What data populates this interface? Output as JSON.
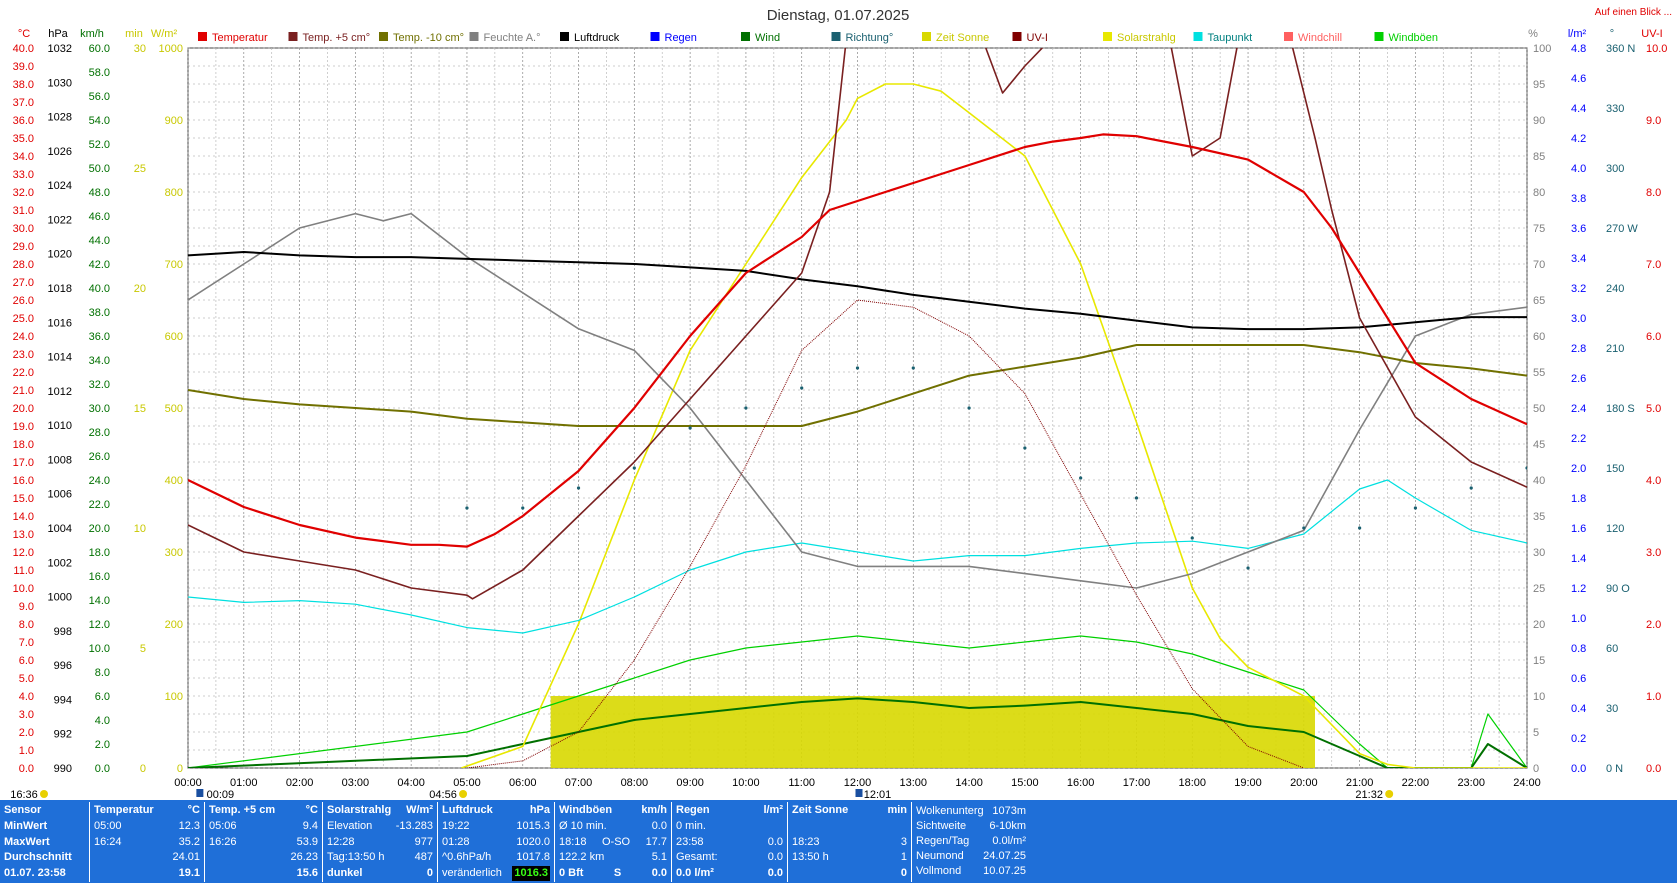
{
  "title": "Dienstag, 01.07.2025",
  "top_link": "Auf einen Blick ...",
  "legend": [
    {
      "label": "Temperatur",
      "color": "#e00000"
    },
    {
      "label": "Temp. +5 cm°",
      "color": "#7a2020"
    },
    {
      "label": "Temp. -10 cm°",
      "color": "#707000"
    },
    {
      "label": "Feuchte A.°",
      "color": "#808080"
    },
    {
      "label": "Luftdruck",
      "color": "#000000"
    },
    {
      "label": "Regen",
      "color": "#0000ff"
    },
    {
      "label": "Wind",
      "color": "#007000"
    },
    {
      "label": "Richtung°",
      "color": "#1a6070"
    },
    {
      "label": "Zeit Sonne",
      "color": "#d8d800"
    },
    {
      "label": "UV-I",
      "color": "#800000"
    },
    {
      "label": "Solarstrahlg",
      "color": "#e8e800"
    },
    {
      "label": "Taupunkt",
      "color": "#00e0e0"
    },
    {
      "label": "Windchill",
      "color": "#ff6060"
    },
    {
      "label": "Windböen",
      "color": "#00d000"
    }
  ],
  "axes": {
    "temp": {
      "unit": "°C",
      "color": "#e00000",
      "ticks": [
        "40.0",
        "39.0",
        "38.0",
        "37.0",
        "36.0",
        "35.0",
        "34.0",
        "33.0",
        "32.0",
        "31.0",
        "30.0",
        "29.0",
        "28.0",
        "27.0",
        "26.0",
        "25.0",
        "24.0",
        "23.0",
        "22.0",
        "21.0",
        "20.0",
        "19.0",
        "18.0",
        "17.0",
        "16.0",
        "15.0",
        "14.0",
        "13.0",
        "12.0",
        "11.0",
        "10.0",
        "9.0",
        "8.0",
        "7.0",
        "6.0",
        "5.0",
        "4.0",
        "3.0",
        "2.0",
        "1.0",
        "0.0"
      ]
    },
    "hpa": {
      "unit": "hPa",
      "color": "#000000",
      "ticks": [
        "1032",
        "1030",
        "1028",
        "1026",
        "1024",
        "1022",
        "1020",
        "1018",
        "1016",
        "1014",
        "1012",
        "1010",
        "1008",
        "1006",
        "1004",
        "1002",
        "1000",
        "998",
        "996",
        "994",
        "992",
        "990"
      ]
    },
    "kmh": {
      "unit": "km/h",
      "color": "#007000",
      "ticks": [
        "60.0",
        "58.0",
        "56.0",
        "54.0",
        "52.0",
        "50.0",
        "48.0",
        "46.0",
        "44.0",
        "42.0",
        "40.0",
        "38.0",
        "36.0",
        "34.0",
        "32.0",
        "30.0",
        "28.0",
        "26.0",
        "24.0",
        "22.0",
        "20.0",
        "18.0",
        "16.0",
        "14.0",
        "12.0",
        "10.0",
        "8.0",
        "6.0",
        "4.0",
        "2.0",
        "0.0"
      ]
    },
    "min": {
      "unit": "min",
      "color": "#c8c800",
      "ticks": [
        "30",
        "25",
        "20",
        "15",
        "10",
        "5",
        "0"
      ]
    },
    "wm2": {
      "unit": "W/m²",
      "color": "#c8c800",
      "ticks": [
        "1000",
        "900",
        "800",
        "700",
        "600",
        "500",
        "400",
        "300",
        "200",
        "100",
        "0"
      ]
    },
    "pct": {
      "unit": "%",
      "color": "#808080",
      "ticks": [
        "100",
        "95",
        "90",
        "85",
        "80",
        "75",
        "70",
        "65",
        "60",
        "55",
        "50",
        "45",
        "40",
        "35",
        "30",
        "25",
        "20",
        "15",
        "10",
        "5",
        "0"
      ]
    },
    "lm2": {
      "unit": "l/m²",
      "color": "#0000ff",
      "ticks": [
        "4.8",
        "4.6",
        "4.4",
        "4.2",
        "4.0",
        "3.8",
        "3.6",
        "3.4",
        "3.2",
        "3.0",
        "2.8",
        "2.6",
        "2.4",
        "2.2",
        "2.0",
        "1.8",
        "1.6",
        "1.4",
        "1.2",
        "1.0",
        "0.8",
        "0.6",
        "0.4",
        "0.2",
        "0.0"
      ]
    },
    "deg": {
      "unit": "°",
      "color": "#1a6070",
      "ticks": [
        "360 N",
        "330",
        "300",
        "270 W",
        "240",
        "210",
        "180 S",
        "150",
        "120",
        "90 O",
        "60",
        "30",
        "0   N"
      ]
    },
    "uv": {
      "unit": "UV-I",
      "color": "#e00000",
      "ticks": [
        "10.0",
        "9.0",
        "8.0",
        "7.0",
        "6.0",
        "5.0",
        "4.0",
        "3.0",
        "2.0",
        "1.0",
        "0.0"
      ]
    },
    "x_ticks": [
      "00:00",
      "01:00",
      "02:00",
      "03:00",
      "04:00",
      "05:00",
      "06:00",
      "07:00",
      "08:00",
      "09:00",
      "10:00",
      "11:00",
      "12:00",
      "13:00",
      "14:00",
      "15:00",
      "16:00",
      "17:00",
      "18:00",
      "19:00",
      "20:00",
      "21:00",
      "22:00",
      "23:00",
      "24:00"
    ]
  },
  "markers": {
    "left_time": "16:36",
    "moonrise": "00:09",
    "sunrise": "04:56",
    "noon": "12:01",
    "sunset": "21:32"
  },
  "chart_data": {
    "type": "line",
    "title": "Dienstag, 01.07.2025",
    "x_unit": "hours",
    "x_range": [
      0,
      24
    ],
    "grid": true,
    "legend_position": "top",
    "series": [
      {
        "name": "Temperatur",
        "axis": "temp",
        "color": "#e00000",
        "x": [
          0,
          1,
          2,
          3,
          4,
          4.5,
          5,
          5.5,
          6,
          7,
          8,
          9,
          10,
          10.5,
          11,
          11.5,
          12,
          13,
          14,
          15,
          15.5,
          16,
          16.4,
          17,
          18,
          19,
          20,
          20.5,
          21,
          22,
          23,
          24
        ],
        "y": [
          16.0,
          14.5,
          13.5,
          12.8,
          12.4,
          12.4,
          12.3,
          13.0,
          14.0,
          16.5,
          20.0,
          24.0,
          27.5,
          28.5,
          29.5,
          31.0,
          31.5,
          32.5,
          33.5,
          34.5,
          34.8,
          35.0,
          35.2,
          35.1,
          34.5,
          33.8,
          32.0,
          30.0,
          27.5,
          22.5,
          20.5,
          19.1
        ]
      },
      {
        "name": "Temp. +5 cm°",
        "axis": "temp",
        "color": "#7a2020",
        "x": [
          0,
          1,
          2,
          3,
          4,
          5,
          5.1,
          6,
          7,
          8,
          9,
          10,
          11,
          11.5,
          11.8,
          12,
          12.5,
          13,
          13.5,
          14,
          14.3,
          14.6,
          15,
          16,
          17,
          17.5,
          18,
          18.5,
          18.8,
          19.2,
          19.8,
          20.2,
          20.5,
          21,
          22,
          23,
          24
        ],
        "y": [
          13.5,
          12.0,
          11.5,
          11.0,
          10.0,
          9.6,
          9.4,
          11.0,
          14.0,
          17.0,
          20.5,
          24.0,
          27.5,
          32.0,
          40.5,
          43.0,
          45.0,
          45.0,
          44.0,
          42.5,
          40.0,
          37.5,
          39.0,
          44.0,
          44.5,
          42.0,
          34.0,
          35.0,
          40.0,
          42.0,
          40.0,
          35.0,
          31.0,
          25.0,
          19.5,
          17.0,
          15.6
        ]
      },
      {
        "name": "Temp. -10 cm°",
        "axis": "temp",
        "color": "#707000",
        "x": [
          0,
          1,
          2,
          3,
          4,
          5,
          6,
          7,
          8,
          9,
          10,
          11,
          12,
          13,
          14,
          15,
          16,
          17,
          18,
          19,
          20,
          21,
          22,
          23,
          24
        ],
        "y": [
          21.0,
          20.5,
          20.2,
          20.0,
          19.8,
          19.4,
          19.2,
          19.0,
          19.0,
          19.0,
          19.0,
          19.0,
          19.8,
          20.8,
          21.8,
          22.3,
          22.8,
          23.5,
          23.5,
          23.5,
          23.5,
          23.1,
          22.5,
          22.2,
          21.8
        ]
      },
      {
        "name": "Feuchte A.°",
        "axis": "pct",
        "color": "#808080",
        "x": [
          0,
          1,
          2,
          3,
          3.5,
          4,
          5,
          6,
          7,
          8,
          9,
          10,
          11,
          12,
          13,
          14,
          15,
          16,
          17,
          18,
          19,
          20,
          21,
          22,
          23,
          24
        ],
        "y": [
          65,
          70,
          75,
          77,
          76,
          77,
          71,
          66,
          61,
          58,
          50,
          40,
          30,
          28,
          28,
          28,
          27,
          26,
          25,
          27,
          30,
          33,
          47,
          60,
          63,
          64
        ]
      },
      {
        "name": "Luftdruck",
        "axis": "hpa",
        "color": "#000000",
        "x": [
          0,
          1,
          2,
          3,
          4,
          5,
          6,
          7,
          8,
          9,
          10,
          11,
          12,
          13,
          14,
          15,
          16,
          17,
          18,
          19,
          20,
          21,
          22,
          23,
          24
        ],
        "y": [
          1019.9,
          1020.1,
          1019.9,
          1019.8,
          1019.8,
          1019.7,
          1019.6,
          1019.5,
          1019.4,
          1019.2,
          1019.0,
          1018.5,
          1018.1,
          1017.6,
          1017.2,
          1016.8,
          1016.5,
          1016.1,
          1015.7,
          1015.6,
          1015.6,
          1015.7,
          1016.0,
          1016.3,
          1016.3
        ]
      },
      {
        "name": "Taupunkt",
        "axis": "temp",
        "color": "#00e0e0",
        "x": [
          0,
          1,
          2,
          3,
          4,
          5,
          6,
          7,
          8,
          9,
          10,
          11,
          12,
          13,
          14,
          15,
          16,
          17,
          18,
          19,
          20,
          21,
          21.5,
          22,
          23,
          24
        ],
        "y": [
          9.5,
          9.2,
          9.3,
          9.1,
          8.5,
          7.8,
          7.5,
          8.2,
          9.5,
          11.0,
          12.0,
          12.5,
          12.0,
          11.5,
          11.8,
          11.8,
          12.2,
          12.5,
          12.6,
          12.2,
          13.0,
          15.5,
          16.0,
          15.0,
          13.2,
          12.5
        ]
      },
      {
        "name": "Solarstrahlg",
        "axis": "wm2",
        "color": "#e8e800",
        "x": [
          4.9,
          6,
          7,
          8,
          9,
          10,
          10.5,
          11,
          11.5,
          11.8,
          12,
          12.5,
          13,
          13.5,
          14,
          14.5,
          15,
          16,
          17,
          18,
          18.5,
          19,
          19.5,
          20,
          21,
          21.5,
          22,
          23,
          24
        ],
        "y": [
          0,
          30,
          200,
          400,
          580,
          700,
          760,
          820,
          870,
          900,
          930,
          950,
          950,
          940,
          910,
          880,
          850,
          700,
          480,
          250,
          180,
          140,
          120,
          100,
          20,
          5,
          0,
          0,
          0
        ]
      },
      {
        "name": "UV-I",
        "axis": "uv",
        "color": "#800000",
        "x": [
          5,
          6,
          7,
          8,
          9,
          10,
          11,
          12,
          13,
          14,
          15,
          16,
          17,
          18,
          18.5,
          19,
          20
        ],
        "y": [
          0,
          0.1,
          0.5,
          1.5,
          2.8,
          4.2,
          5.8,
          6.5,
          6.4,
          6.0,
          5.2,
          3.8,
          2.4,
          1.1,
          0.7,
          0.3,
          0
        ]
      },
      {
        "name": "Wind",
        "axis": "kmh",
        "color": "#007000",
        "x": [
          0,
          5,
          6,
          7,
          8,
          9,
          10,
          11,
          12,
          13,
          14,
          15,
          16,
          17,
          18,
          19,
          20,
          21,
          21.5,
          23,
          23.3,
          24
        ],
        "y": [
          0,
          1.0,
          2.0,
          3.0,
          4.0,
          4.5,
          5.0,
          5.5,
          5.8,
          5.5,
          5.0,
          5.2,
          5.5,
          5.0,
          4.5,
          3.5,
          3.0,
          1.0,
          0.0,
          0.0,
          2.0,
          0.0
        ]
      },
      {
        "name": "Windböen",
        "axis": "kmh",
        "color": "#00d000",
        "x": [
          0,
          5,
          6,
          7,
          8,
          9,
          10,
          11,
          12,
          13,
          14,
          15,
          16,
          17,
          18,
          19,
          20,
          21,
          21.5,
          23,
          23.3,
          24
        ],
        "y": [
          0,
          3.0,
          4.5,
          6.0,
          7.5,
          9.0,
          10.0,
          10.5,
          11.0,
          10.5,
          10.0,
          10.5,
          11.0,
          10.5,
          9.5,
          8.0,
          6.5,
          2.0,
          0.0,
          0.0,
          4.5,
          0.0
        ]
      },
      {
        "name": "Richtung°",
        "axis": "deg",
        "color": "#1a6070",
        "x": [
          5,
          6,
          7,
          8,
          9,
          10,
          11,
          12,
          13,
          14,
          15,
          16,
          17,
          18,
          19,
          20,
          21,
          22,
          23,
          24
        ],
        "y": [
          130,
          130,
          140,
          150,
          170,
          180,
          190,
          200,
          200,
          180,
          160,
          145,
          135,
          115,
          100,
          120,
          120,
          130,
          140,
          150
        ]
      }
    ],
    "sunshine": {
      "name": "Zeit Sonne",
      "axis": "min",
      "color": "#d8d800",
      "x_start": 6.5,
      "x_end": 20.2,
      "value": 3
    }
  },
  "summary": {
    "sensor": {
      "header": "Sensor",
      "rows": [
        "MinWert",
        "MaxWert",
        "Durchschnitt",
        "01.07. 23:58"
      ]
    },
    "temp": {
      "header": "Temperatur",
      "unit": "°C",
      "rows": [
        [
          "05:00",
          "12.3"
        ],
        [
          "16:24",
          "35.2"
        ],
        [
          "",
          "24.01"
        ],
        [
          "",
          "19.1"
        ]
      ]
    },
    "temp5": {
      "header": "Temp. +5 cm",
      "unit": "°C",
      "rows": [
        [
          "05:06",
          "9.4"
        ],
        [
          "16:26",
          "53.9"
        ],
        [
          "",
          "26.23"
        ],
        [
          "",
          "15.6"
        ]
      ]
    },
    "solar": {
      "header": "Solarstrahlg",
      "unit": "W/m²",
      "rows": [
        [
          "Elevation",
          "-13.283"
        ],
        [
          "12:28",
          "977"
        ],
        [
          "Tag:13:50 h",
          "487"
        ],
        [
          "dunkel",
          "0"
        ]
      ]
    },
    "press": {
      "header": "Luftdruck",
      "unit": "hPa",
      "rows": [
        [
          "19:22",
          "1015.3"
        ],
        [
          "01:28",
          "1020.0"
        ],
        [
          "^0.6hPa/h",
          "1017.8"
        ],
        [
          "veränderlich",
          "1016.3"
        ]
      ]
    },
    "gust": {
      "header": "Windböen",
      "unit": "km/h",
      "rows": [
        [
          "Ø 10 min.",
          "",
          "0.0"
        ],
        [
          "18:18",
          "O-SO",
          "17.7"
        ],
        [
          "122.2 km",
          "",
          "5.1"
        ],
        [
          "0 Bft",
          "S",
          "0.0"
        ]
      ]
    },
    "rain": {
      "header": "Regen",
      "unit": "l/m²",
      "rows": [
        [
          "0 min.",
          ""
        ],
        [
          "23:58",
          "0.0"
        ],
        [
          "Gesamt:",
          "0.0"
        ],
        [
          "0.0 l/m²",
          "0.0"
        ]
      ]
    },
    "sun": {
      "header": "Zeit Sonne",
      "unit": "min",
      "rows": [
        [
          "",
          ""
        ],
        [
          "18:23",
          "3"
        ],
        [
          "13:50 h",
          "1"
        ],
        [
          "",
          "0"
        ]
      ]
    },
    "extra": {
      "rows": [
        [
          "Wolkenunterg",
          "1073m"
        ],
        [
          "Sichtweite",
          "6-10km"
        ],
        [
          "Regen/Tag",
          "0.0l/m²"
        ],
        [
          "Neumond",
          "24.07.25"
        ],
        [
          "Vollmond",
          "10.07.25"
        ]
      ]
    }
  }
}
